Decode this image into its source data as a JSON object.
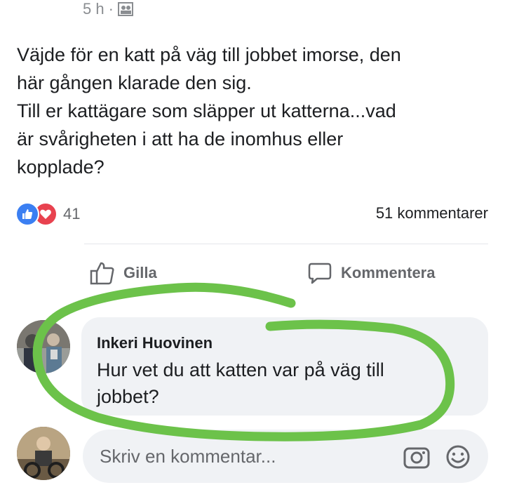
{
  "post": {
    "time": "5 h",
    "separator": "·",
    "audience_icon": "friends-icon",
    "text": "Väjde för en katt på väg till jobbet imorse, den\nhär gången klarade den sig.\nTill er kattägare som släpper ut katterna...vad\när svårigheten i att ha de inomhus eller\nkopplade?"
  },
  "reactions": {
    "icons": [
      "like-icon",
      "love-icon"
    ],
    "count": "41",
    "comments": "51 kommentarer"
  },
  "actions": {
    "like_label": "Gilla",
    "comment_label": "Kommentera"
  },
  "comment": {
    "author": "Inkeri Huovinen",
    "text": "Hur vet du att katten var på väg till\njobbet?"
  },
  "composer": {
    "placeholder": "Skriv en kommentar..."
  },
  "colors": {
    "like_blue": "#3b7ff2",
    "love_red": "#e8424f",
    "highlight_green": "#6cc24a",
    "bubble_bg": "#f0f2f5"
  }
}
